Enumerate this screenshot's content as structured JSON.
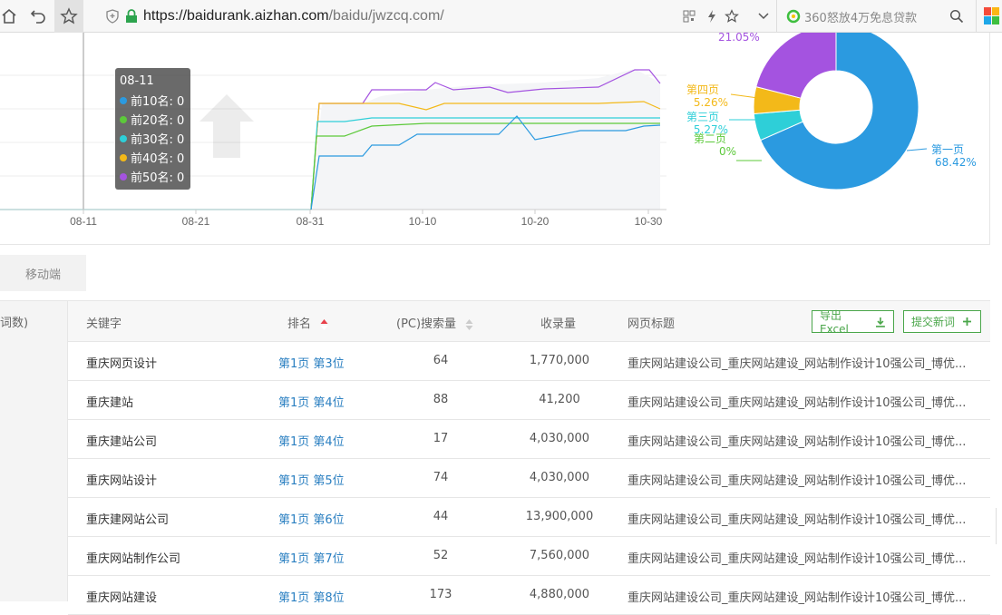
{
  "browser": {
    "url_domain": "https://baidurank.aizhan.com",
    "url_path": "/baidu/jwzcq.com/",
    "search_placeholder": "360怒放4万免息贷款"
  },
  "chart_data": [
    {
      "type": "line",
      "x_ticks": [
        "08-11",
        "08-21",
        "08-31",
        "10-10",
        "10-20",
        "10-30"
      ],
      "tooltip": {
        "title": "08-11",
        "items": [
          {
            "label": "前10名: 0",
            "color": "#2b9ae0"
          },
          {
            "label": "前20名: 0",
            "color": "#5cc93a"
          },
          {
            "label": "前30名: 0",
            "color": "#2ecfd8"
          },
          {
            "label": "前40名: 0",
            "color": "#f3b919"
          },
          {
            "label": "前50名: 0",
            "color": "#a453e0"
          }
        ]
      },
      "series": [
        {
          "name": "前10名",
          "color": "#2b9ae0"
        },
        {
          "name": "前20名",
          "color": "#5cc93a"
        },
        {
          "name": "前30名",
          "color": "#2ecfd8"
        },
        {
          "name": "前40名",
          "color": "#f3b919"
        },
        {
          "name": "前50名",
          "color": "#a453e0"
        }
      ],
      "grid": true
    },
    {
      "type": "pie",
      "slices": [
        {
          "label": "第一页",
          "pct": "68.42%",
          "value": 68.42,
          "color": "#2b9ae0"
        },
        {
          "label": "第二页",
          "pct": "0%",
          "value": 0,
          "color": "#5cc93a"
        },
        {
          "label": "第三页",
          "pct": "5.27%",
          "value": 5.27,
          "color": "#2ecfd8"
        },
        {
          "label": "第四页",
          "pct": "5.26%",
          "value": 5.26,
          "color": "#f3b919"
        },
        {
          "label": "",
          "pct": "21.05%",
          "value": 21.05,
          "color": "#a453e0"
        }
      ]
    }
  ],
  "tabs": {
    "mobile": "移动端"
  },
  "table": {
    "left_header": "词数)",
    "headers": {
      "keyword": "关键字",
      "rank": "排名",
      "volume": "(PC)搜索量",
      "index": "收录量",
      "title": "网页标题"
    },
    "export_label": "导出Excel",
    "submit_label": "提交新词",
    "rows": [
      {
        "keyword": "重庆网页设计",
        "rank": "第1页 第3位",
        "volume": "64",
        "index": "1,770,000",
        "title": "重庆网站建设公司_重庆网站建设_网站制作设计10强公司_博优..."
      },
      {
        "keyword": "重庆建站",
        "rank": "第1页 第4位",
        "volume": "88",
        "index": "41,200",
        "title": "重庆网站建设公司_重庆网站建设_网站制作设计10强公司_博优..."
      },
      {
        "keyword": "重庆建站公司",
        "rank": "第1页 第4位",
        "volume": "17",
        "index": "4,030,000",
        "title": "重庆网站建设公司_重庆网站建设_网站制作设计10强公司_博优..."
      },
      {
        "keyword": "重庆网站设计",
        "rank": "第1页 第5位",
        "volume": "74",
        "index": "4,030,000",
        "title": "重庆网站建设公司_重庆网站建设_网站制作设计10强公司_博优..."
      },
      {
        "keyword": "重庆建网站公司",
        "rank": "第1页 第6位",
        "volume": "44",
        "index": "13,900,000",
        "title": "重庆网站建设公司_重庆网站建设_网站制作设计10强公司_博优..."
      },
      {
        "keyword": "重庆网站制作公司",
        "rank": "第1页 第7位",
        "volume": "52",
        "index": "7,560,000",
        "title": "重庆网站建设公司_重庆网站建设_网站制作设计10强公司_博优..."
      },
      {
        "keyword": "重庆网站建设",
        "rank": "第1页 第8位",
        "volume": "173",
        "index": "4,880,000",
        "title": "重庆网站建设公司_重庆网站建设_网站制作设计10强公司_博优..."
      }
    ]
  }
}
